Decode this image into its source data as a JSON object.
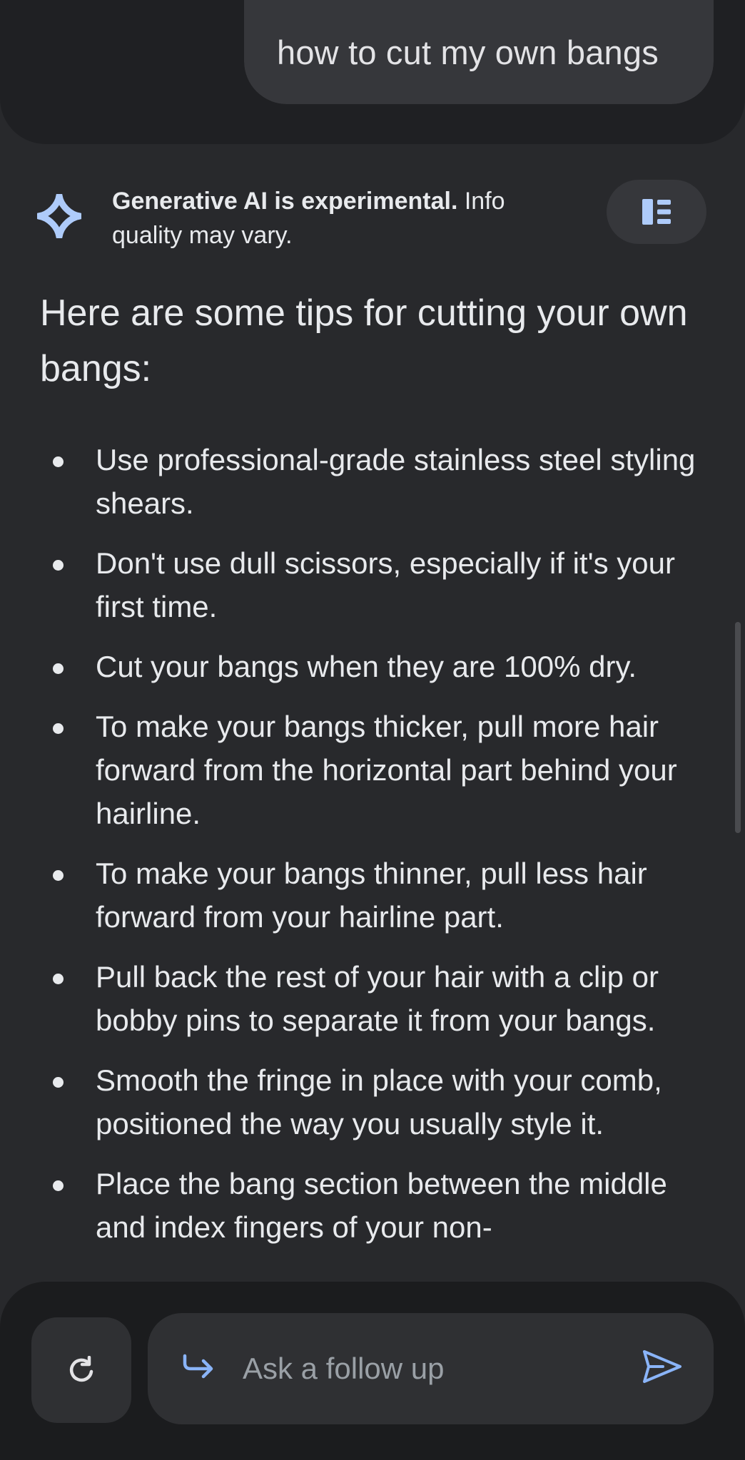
{
  "query": {
    "text": "how to cut my own bangs"
  },
  "disclaimer": {
    "bold": "Generative AI is experimental.",
    "rest": " Info quality may vary.",
    "icon": "sparkle-icon",
    "layout_icon": "view-layout-icon"
  },
  "answer": {
    "heading": "Here are some tips for cutting your own bangs:",
    "tips": [
      "Use professional-grade stainless steel styling shears.",
      "Don't use dull scissors, especially if it's your first time.",
      "Cut your bangs when they are 100% dry.",
      "To make your bangs thicker, pull more hair forward from the horizontal part behind your hairline.",
      "To make your bangs thinner, pull less hair forward from your hairline part.",
      "Pull back the rest of your hair with a clip or bobby pins to separate it from your bangs.",
      "Smooth the fringe in place with your comb, positioned the way you usually style it.",
      "Place the bang section between the middle and index fingers of your non-"
    ]
  },
  "bottom_bar": {
    "refresh_icon": "refresh-icon",
    "followup_icon": "reply-arrow-icon",
    "placeholder": "Ask a follow up",
    "send_icon": "send-icon"
  },
  "colors": {
    "background": "#28292c",
    "panel": "#1f2023",
    "bubble": "#36373b",
    "accent": "#8ab4f8",
    "text": "#e8eaed",
    "muted": "#9aa0a6"
  }
}
